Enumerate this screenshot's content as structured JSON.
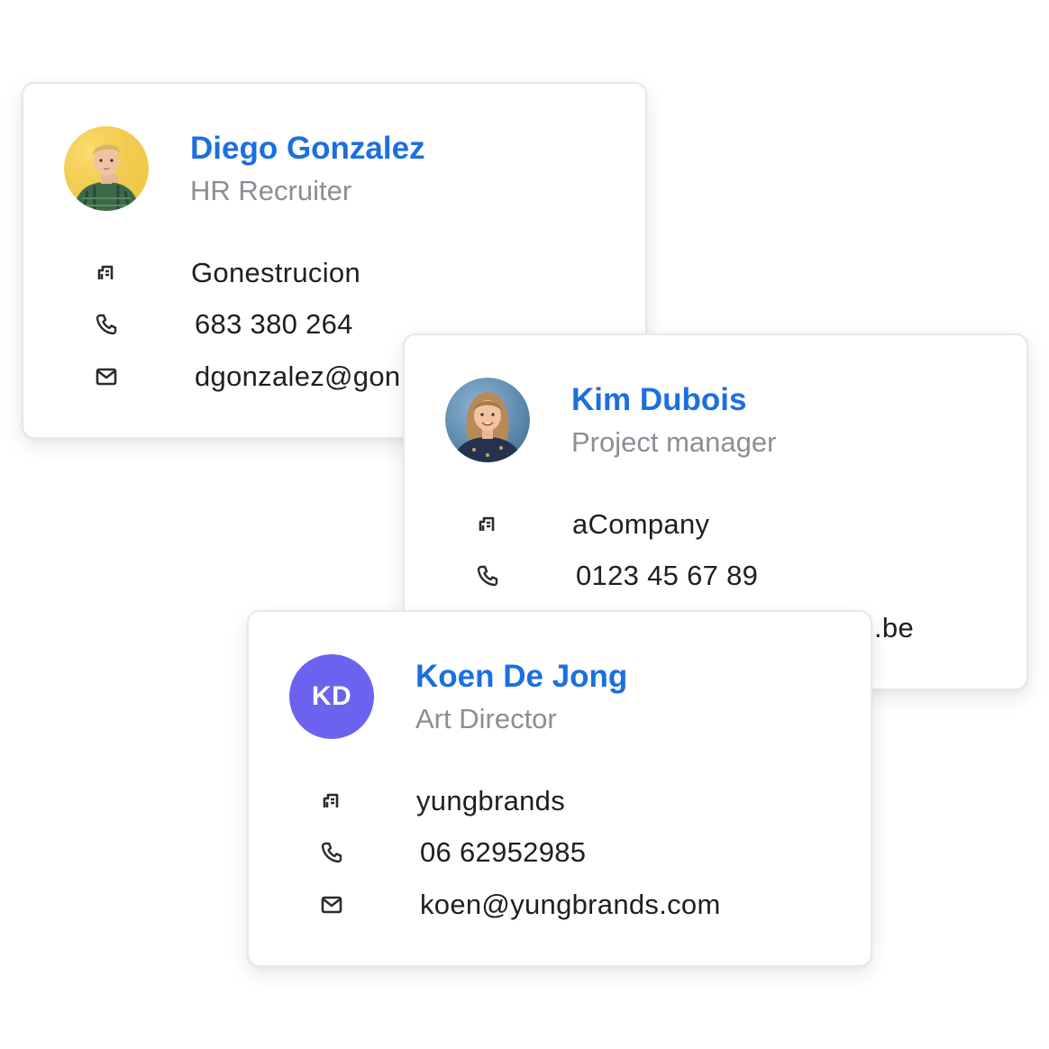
{
  "colors": {
    "name_blue": "#1b6fe0",
    "initials_bg": "#6b63f0",
    "icon": "#2a2b2e"
  },
  "cards": [
    {
      "name": "Diego Gonzalez",
      "role": "HR Recruiter",
      "avatar": "photo-young-man-yellow-bg",
      "company": "Gonestrucion",
      "phone": "683 380 264",
      "email": "dgonzalez@gon"
    },
    {
      "name": "Kim Dubois",
      "role": "Project manager",
      "avatar": "photo-woman-blue-bg",
      "company": "aCompany",
      "phone": "0123 45 67 89",
      "email_visible_fragment": ".be"
    },
    {
      "name": "Koen De Jong",
      "role": "Art Director",
      "avatar_initials": "KD",
      "company": "yungbrands",
      "phone": "06 62952985",
      "email": "koen@yungbrands.com"
    }
  ],
  "icons": {
    "company": "building-icon",
    "phone": "phone-icon",
    "email": "mail-icon"
  }
}
